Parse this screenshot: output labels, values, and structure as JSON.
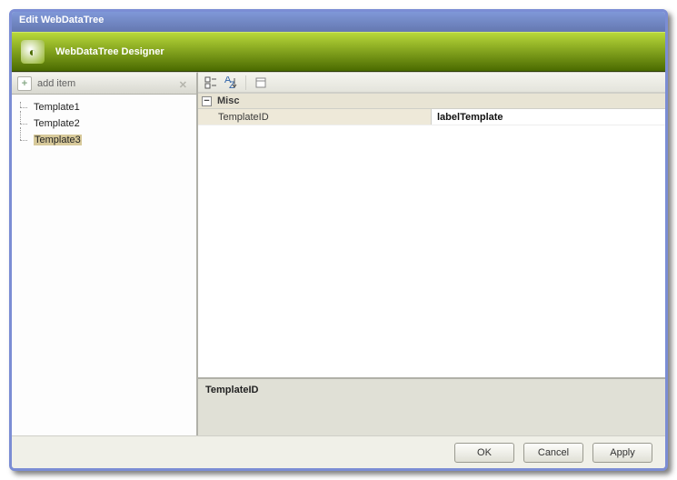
{
  "window": {
    "title": "Edit WebDataTree"
  },
  "banner": {
    "title": "WebDataTree Designer"
  },
  "sidebar": {
    "add_label": "add item",
    "items": [
      {
        "label": "Template1"
      },
      {
        "label": "Template2"
      },
      {
        "label": "Template3"
      }
    ],
    "selected_index": 2
  },
  "toolbar": {
    "btn_categorized": "categorized-icon",
    "btn_alpha": "alphabetical-icon",
    "btn_pages": "property-pages-icon"
  },
  "propgrid": {
    "category": "Misc",
    "rows": [
      {
        "name": "TemplateID",
        "value": "labelTemplate"
      }
    ]
  },
  "desc": {
    "title": "TemplateID"
  },
  "footer": {
    "ok": "OK",
    "cancel": "Cancel",
    "apply": "Apply"
  }
}
